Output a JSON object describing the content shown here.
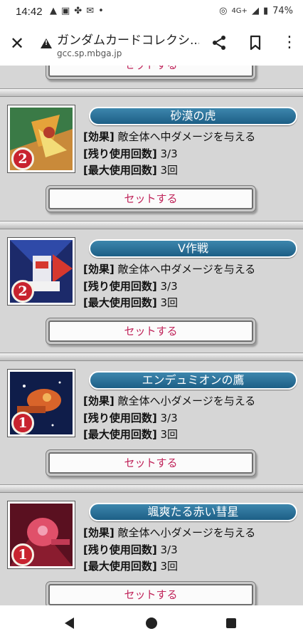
{
  "status_bar": {
    "time": "14:42",
    "left_icons": [
      "warning-icon",
      "tv-icon",
      "pinwheel-icon",
      "mail-icon",
      "dot-icon"
    ],
    "network": "4G+",
    "battery": "74%"
  },
  "browser": {
    "title": "ガンダムカードコレクシ...",
    "url": "gcc.sp.mbga.jp"
  },
  "partial_button_label": "セットする",
  "cards": [
    {
      "name": "砂漠の虎",
      "rank": "2",
      "effect_tag": "[効果]",
      "effect": "敵全体へ中ダメージを与える",
      "remaining_tag": "[残り使用回数]",
      "remaining": "3/3",
      "max_tag": "[最大使用回数]",
      "max": "3回",
      "button": "セットする",
      "art_colors": [
        "#2c6a3a",
        "#e28a2a",
        "#f6e07a"
      ]
    },
    {
      "name": "V作戦",
      "rank": "2",
      "effect_tag": "[効果]",
      "effect": "敵全体へ中ダメージを与える",
      "remaining_tag": "[残り使用回数]",
      "remaining": "3/3",
      "max_tag": "[最大使用回数]",
      "max": "3回",
      "button": "セットする",
      "art_colors": [
        "#1e2a6e",
        "#e8e8ef",
        "#d6382e"
      ]
    },
    {
      "name": "エンデュミオンの鷹",
      "rank": "1",
      "effect_tag": "[効果]",
      "effect": "敵全体へ小ダメージを与える",
      "remaining_tag": "[残り使用回数]",
      "remaining": "3/3",
      "max_tag": "[最大使用回数]",
      "max": "3回",
      "button": "セットする",
      "art_colors": [
        "#0f1d4a",
        "#d9642a",
        "#f2b35a"
      ]
    },
    {
      "name": "颯爽たる赤い彗星",
      "rank": "1",
      "effect_tag": "[効果]",
      "effect": "敵全体へ小ダメージを与える",
      "remaining_tag": "[残り使用回数]",
      "remaining": "3/3",
      "max_tag": "[最大使用回数]",
      "max": "3回",
      "button": "セットする",
      "art_colors": [
        "#5a1020",
        "#e0506a",
        "#f3a0b4"
      ]
    }
  ],
  "nav": [
    "back-icon",
    "home-icon",
    "recents-icon"
  ]
}
